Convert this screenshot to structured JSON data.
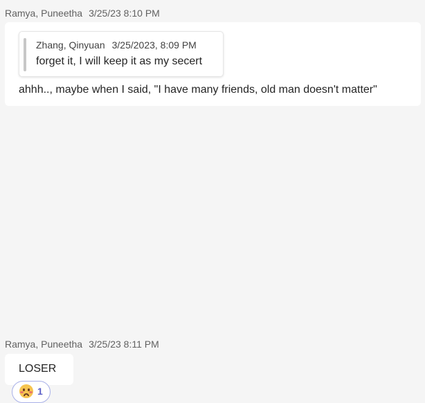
{
  "messages": [
    {
      "author": "Ramya, Puneetha",
      "timestamp": "3/25/23 8:10 PM",
      "quote": {
        "author": "Zhang, Qinyuan",
        "timestamp": "3/25/2023, 8:09 PM",
        "text": "forget it, I will keep it as my secert"
      },
      "text": "ahhh.., maybe when I said, \"I have many friends, old man doesn't matter\""
    },
    {
      "author": "Ramya, Puneetha",
      "timestamp": "3/25/23 8:11 PM",
      "text": "LOSER",
      "reaction": {
        "emoji": "woozy-face-icon",
        "count": "1",
        "accent": "#5b5fc7"
      }
    }
  ],
  "colors": {
    "background": "#f5f5f5",
    "bubble": "#ffffff",
    "meta_text": "#616161",
    "reaction_border": "#a8b0e8"
  }
}
